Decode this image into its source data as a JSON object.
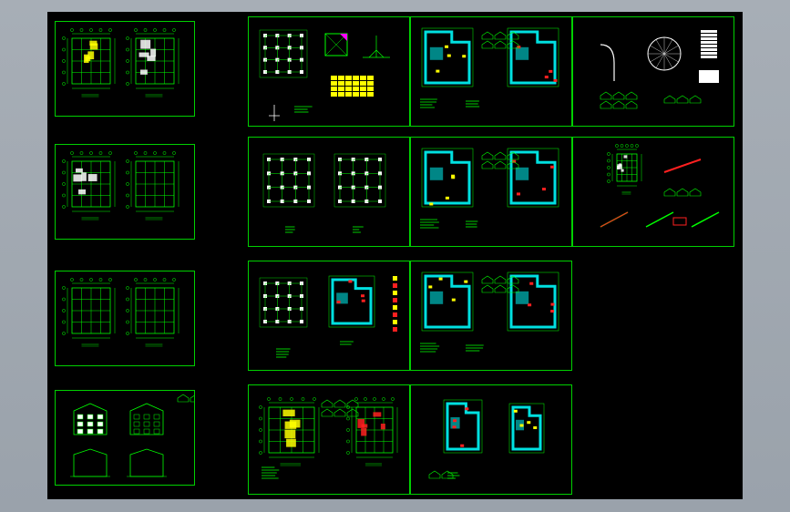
{
  "app": {
    "title": "",
    "canvas_background": "#000000",
    "outer_background": "#9ea6ae"
  },
  "colors": {
    "frame": "#00d000",
    "line": "#00ff00",
    "cyan_fill": "#00e0e0",
    "red": "#ff2020",
    "yellow": "#ffff00",
    "magenta": "#ff00ff",
    "white": "#ffffff"
  },
  "sheets": [
    {
      "id": "s1",
      "kind": "plan-pair",
      "highlight": "yellow"
    },
    {
      "id": "s2",
      "kind": "plan-pair",
      "highlight": "white"
    },
    {
      "id": "s3",
      "kind": "plan-pair",
      "highlight": "none"
    },
    {
      "id": "s4",
      "kind": "elevations",
      "highlight": "white"
    },
    {
      "id": "s5",
      "kind": "foundation",
      "highlight": "magenta"
    },
    {
      "id": "s6",
      "kind": "structure-cyan",
      "highlight": "cyan"
    },
    {
      "id": "s7",
      "kind": "stair-details",
      "highlight": "white"
    },
    {
      "id": "s8",
      "kind": "column-grid",
      "highlight": "none"
    },
    {
      "id": "s9",
      "kind": "structure-cyan",
      "highlight": "cyan"
    },
    {
      "id": "s10",
      "kind": "details",
      "highlight": "red"
    },
    {
      "id": "s11",
      "kind": "column-grid-cyan",
      "highlight": "cyan"
    },
    {
      "id": "s12",
      "kind": "structure-cyan",
      "highlight": "cyan"
    },
    {
      "id": "s13",
      "kind": "rebar-plans",
      "highlight": "red"
    },
    {
      "id": "s14",
      "kind": "structure-cyan-small",
      "highlight": "cyan"
    }
  ]
}
